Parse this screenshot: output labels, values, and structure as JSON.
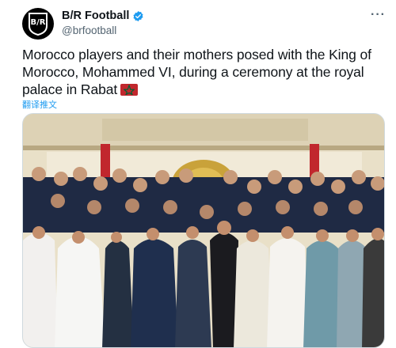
{
  "account": {
    "display_name": "B/R Football",
    "handle": "@brfootball",
    "avatar_text": "B/R",
    "verified": true
  },
  "tweet": {
    "text": "Morocco players and their mothers posed with the King of Morocco, Mohammed VI, during a ceremony at the royal palace in Rabat",
    "flag_icon": "morocco-flag-icon",
    "translate_label": "翻译推文",
    "more_label": "···"
  },
  "media": {
    "description_icon": "photo"
  },
  "colors": {
    "link": "#1d9bf0",
    "verified": "#1d9bf0",
    "secondary_text": "#536471",
    "flag_red": "#c1272d",
    "flag_green": "#006233"
  }
}
